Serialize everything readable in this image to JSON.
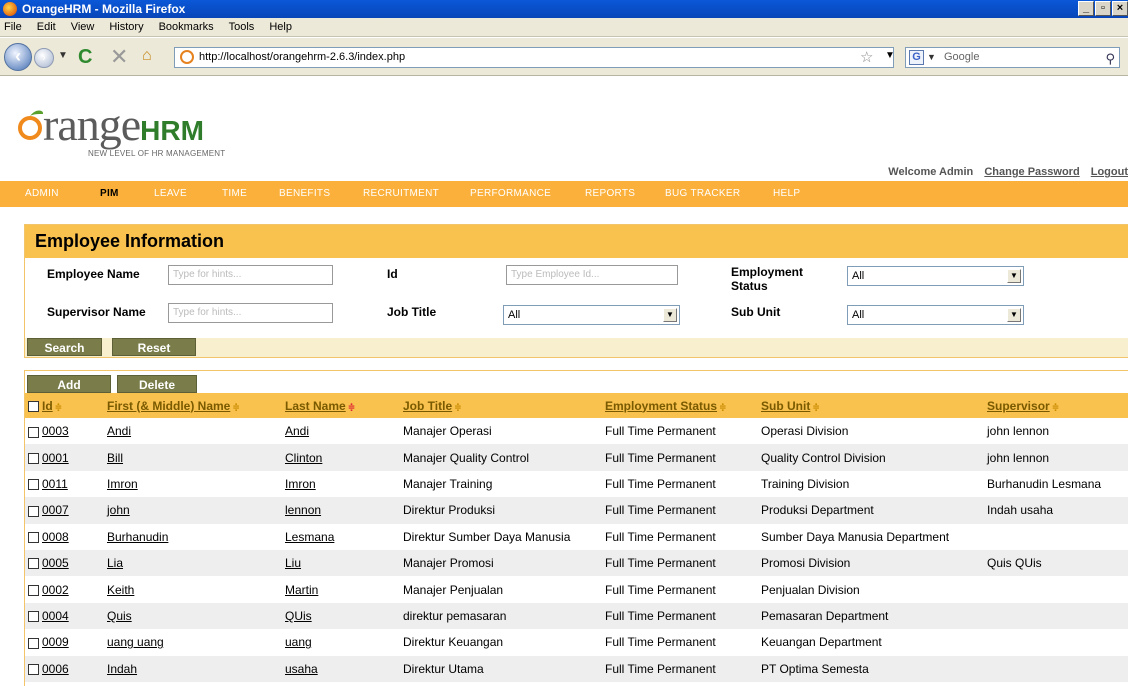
{
  "window": {
    "title": "OrangeHRM - Mozilla Firefox",
    "min": "_",
    "max": "▫",
    "close": "×"
  },
  "menu": [
    "File",
    "Edit",
    "View",
    "History",
    "Bookmarks",
    "Tools",
    "Help"
  ],
  "nav": {
    "url": "http://localhost/orangehrm-2.6.3/index.php",
    "search_placeholder": "Google"
  },
  "header": {
    "logo_main": "range",
    "logo_hrm": "HRM",
    "tagline": "NEW LEVEL OF HR MANAGEMENT",
    "welcome": "Welcome Admin",
    "change_password": "Change Password",
    "logout": "Logout"
  },
  "main_nav": [
    {
      "label": "Admin",
      "active": false
    },
    {
      "label": "PIM",
      "active": true
    },
    {
      "label": "Leave",
      "active": false
    },
    {
      "label": "Time",
      "active": false
    },
    {
      "label": "Benefits",
      "active": false
    },
    {
      "label": "Recruitment",
      "active": false
    },
    {
      "label": "Performance",
      "active": false
    },
    {
      "label": "Reports",
      "active": false
    },
    {
      "label": "Bug Tracker",
      "active": false
    },
    {
      "label": "Help",
      "active": false
    }
  ],
  "search": {
    "title": "Employee Information",
    "employee_name_label": "Employee Name",
    "employee_name_placeholder": "Type for hints...",
    "id_label": "Id",
    "id_placeholder": "Type Employee Id...",
    "employment_status_label_1": "Employment",
    "employment_status_label_2": "Status",
    "employment_status_value": "All",
    "supervisor_label": "Supervisor Name",
    "supervisor_placeholder": "Type for hints...",
    "job_title_label": "Job Title",
    "job_title_value": "All",
    "sub_unit_label": "Sub Unit",
    "sub_unit_value": "All",
    "search_button": "Search",
    "reset_button": "Reset"
  },
  "results": {
    "add_button": "Add",
    "delete_button": "Delete",
    "columns": [
      "Id",
      "First (& Middle) Name",
      "Last Name",
      "Job Title",
      "Employment Status",
      "Sub Unit",
      "Supervisor"
    ],
    "rows": [
      {
        "id": "0003",
        "first": "Andi",
        "last": "Andi",
        "job": "Manajer Operasi",
        "status": "Full Time Permanent",
        "unit": "Operasi Division",
        "supervisor": "john lennon"
      },
      {
        "id": "0001",
        "first": "Bill",
        "last": "Clinton",
        "job": "Manajer Quality Control",
        "status": "Full Time Permanent",
        "unit": "Quality Control Division",
        "supervisor": "john lennon"
      },
      {
        "id": "0011",
        "first": "Imron",
        "last": "Imron",
        "job": "Manajer Training",
        "status": "Full Time Permanent",
        "unit": "Training Division",
        "supervisor": "Burhanudin Lesmana"
      },
      {
        "id": "0007",
        "first": "john",
        "last": "lennon",
        "job": "Direktur Produksi",
        "status": "Full Time Permanent",
        "unit": "Produksi Department",
        "supervisor": "Indah usaha"
      },
      {
        "id": "0008",
        "first": "Burhanudin",
        "last": "Lesmana",
        "job": "Direktur Sumber Daya Manusia",
        "status": "Full Time Permanent",
        "unit": "Sumber Daya Manusia Department",
        "supervisor": ""
      },
      {
        "id": "0005",
        "first": "Lia",
        "last": "Liu",
        "job": "Manajer Promosi",
        "status": "Full Time Permanent",
        "unit": "Promosi Division",
        "supervisor": "Quis QUis"
      },
      {
        "id": "0002",
        "first": "Keith",
        "last": "Martin",
        "job": "Manajer Penjualan",
        "status": "Full Time Permanent",
        "unit": "Penjualan Division",
        "supervisor": ""
      },
      {
        "id": "0004",
        "first": "Quis",
        "last": "QUis",
        "job": "direktur pemasaran",
        "status": "Full Time Permanent",
        "unit": "Pemasaran Department",
        "supervisor": ""
      },
      {
        "id": "0009",
        "first": "uang uang",
        "last": "uang",
        "job": "Direktur Keuangan",
        "status": "Full Time Permanent",
        "unit": "Keuangan Department",
        "supervisor": ""
      },
      {
        "id": "0006",
        "first": "Indah",
        "last": "usaha",
        "job": "Direktur Utama",
        "status": "Full Time Permanent",
        "unit": "PT Optima Semesta",
        "supervisor": ""
      }
    ]
  },
  "colors": {
    "accent": "#fbb03b",
    "panel_header": "#f9c24e",
    "button": "#7a7d4a"
  }
}
